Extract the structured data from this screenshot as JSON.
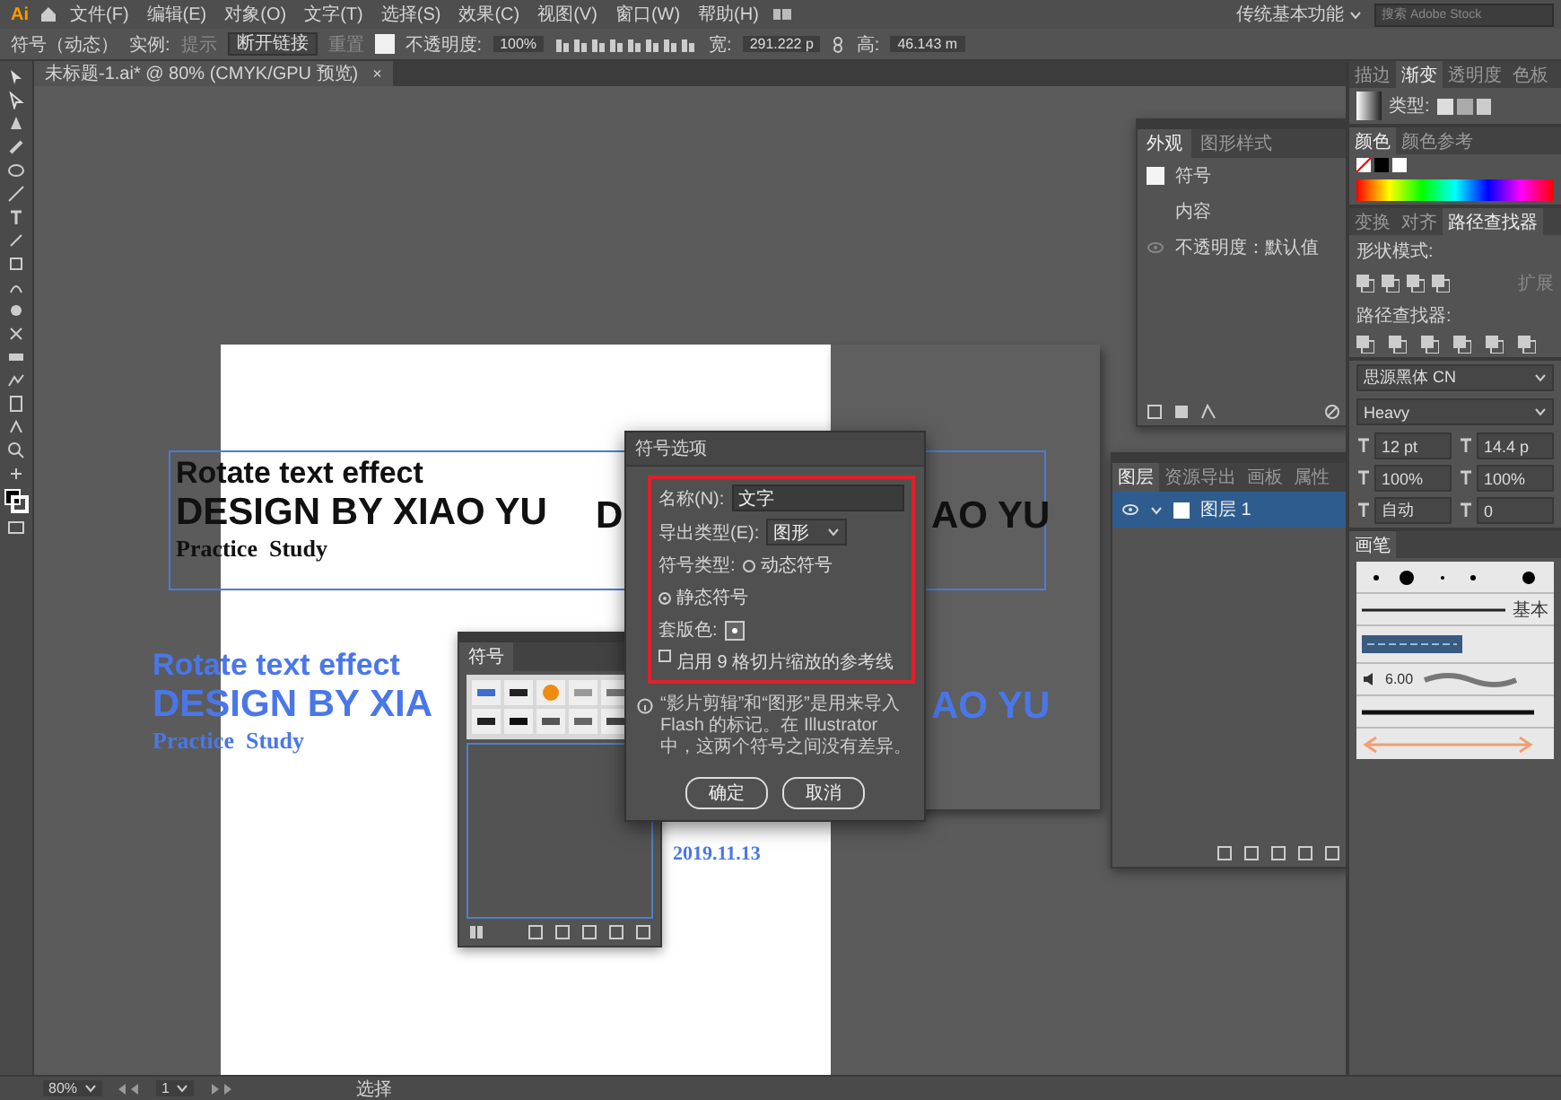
{
  "app": {
    "logo": "Ai",
    "menu": [
      {
        "label": "文件(F)"
      },
      {
        "label": "编辑(E)"
      },
      {
        "label": "对象(O)"
      },
      {
        "label": "文字(T)"
      },
      {
        "label": "选择(S)"
      },
      {
        "label": "效果(C)"
      },
      {
        "label": "视图(V)"
      },
      {
        "label": "窗口(W)"
      },
      {
        "label": "帮助(H)"
      }
    ],
    "workspace": "传统基本功能",
    "search": {
      "placeholder": "搜索 Adobe Stock"
    }
  },
  "control_bar": {
    "object_type": "符号（动态）",
    "instance_label": "实例:",
    "instance_value": "提示",
    "break_link_button": "断开链接",
    "reset_button": "重置",
    "opacity_label": "不透明度:",
    "opacity_value": "100%",
    "width_label": "宽:",
    "width_value": "291.222 p",
    "height_label": "高:",
    "height_value": "46.143 m"
  },
  "document_tab": {
    "title": "未标题-1.ai* @ 80% (CMYK/GPU 预览)",
    "close": "×"
  },
  "canvas": {
    "black_text": {
      "line_1": "Rotate text effect",
      "line_2": "DESIGN BY XIAO YU",
      "line_3": "Practice  Study"
    },
    "duplicate_fragments": [
      "D",
      "AO YU"
    ],
    "blue_text": {
      "line_1": "Rotate text effect",
      "line_2": "DESIGN BY XIA",
      "line_2_tail": "AO YU",
      "line_3": "Practice  Study",
      "date": "2019.11.13"
    }
  },
  "symbols_panel": {
    "title": "符号"
  },
  "dialog": {
    "title": "符号选项",
    "name_label": "名称(N):",
    "name_value": "文字",
    "export_label": "导出类型(E):",
    "export_value": "图形",
    "symbol_type_label": "符号类型:",
    "symbol_types": [
      {
        "label": "动态符号",
        "selected": false
      },
      {
        "label": "静态符号",
        "selected": true
      }
    ],
    "registration_label": "套版色:",
    "nine_slice": {
      "label": "启用 9 格切片缩放的参考线",
      "checked": false
    },
    "info": "“影片剪辑”和“图形”是用来导入 Flash 的标记。在 Illustrator 中，这两个符号之间没有差异。",
    "buttons": [
      {
        "label": "确定"
      },
      {
        "label": "取消"
      }
    ]
  },
  "appearance_panel": {
    "tabs": [
      {
        "label": "外观",
        "selected": true
      },
      {
        "label": "图形样式",
        "selected": false
      }
    ],
    "rows": [
      {
        "label": "符号",
        "kind": "swatch"
      },
      {
        "label": "内容",
        "kind": "plain"
      },
      {
        "label": "不透明度：默认值",
        "kind": "eye"
      }
    ]
  },
  "layers_panel": {
    "tabs": [
      {
        "label": "图层",
        "selected": true
      },
      {
        "label": "资源导出",
        "selected": false
      },
      {
        "label": "画板",
        "selected": false
      },
      {
        "label": "属性",
        "selected": false
      }
    ],
    "layers": [
      {
        "name": "图层 1",
        "selected": true
      }
    ]
  },
  "dock": {
    "tabs": [
      {
        "label": "描边",
        "selected": false
      },
      {
        "label": "渐变",
        "selected": true
      },
      {
        "label": "透明度",
        "selected": false
      },
      {
        "label": "色板",
        "selected": false
      }
    ],
    "gradient_type_label": "类型:",
    "color_tabs": [
      {
        "label": "颜色",
        "selected": true
      },
      {
        "label": "颜色参考",
        "selected": false
      }
    ],
    "pathfinder_tabs": [
      {
        "label": "变换",
        "selected": false
      },
      {
        "label": "对齐",
        "selected": false
      },
      {
        "label": "路径查找器",
        "selected": true
      }
    ],
    "shape_modes_label": "形状模式:",
    "expand_button": "扩展",
    "pathfinders_label": "路径查找器:",
    "character": {
      "font": "思源黑体 CN",
      "style": "Heavy",
      "size": "12 pt",
      "leading": "14.4 p",
      "vertical_scale": "100%",
      "horizontal_scale": "100%",
      "kerning": "自动",
      "tracking": "0"
    },
    "brushes": {
      "title": "画笔",
      "basic_label": "基本",
      "size_label": "6.00"
    }
  },
  "status_bar": {
    "zoom": "80%",
    "artboard": "1",
    "tool": "选择"
  }
}
